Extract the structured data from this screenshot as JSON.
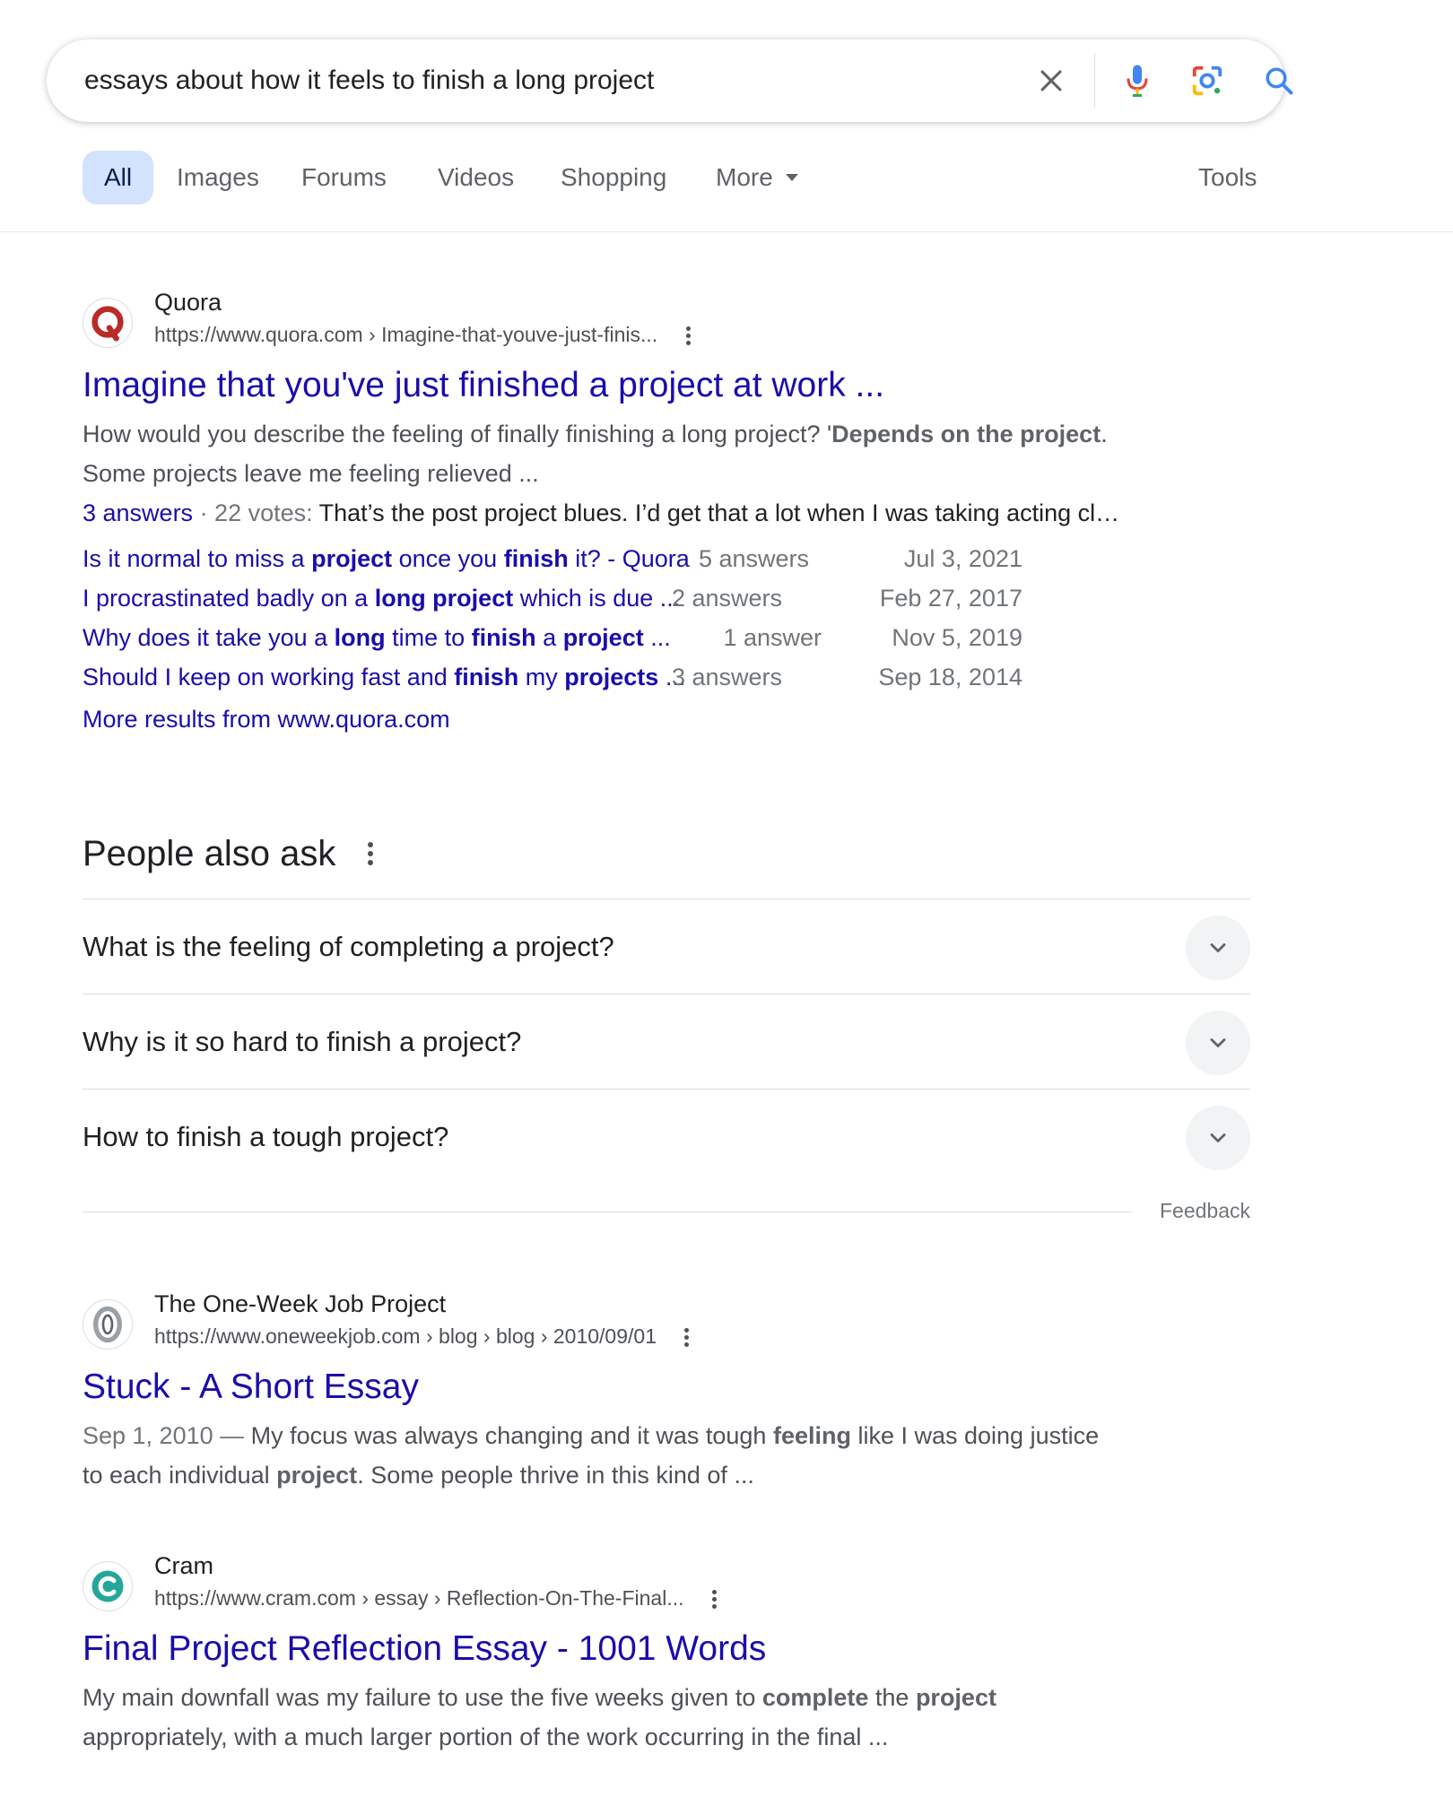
{
  "search": {
    "query": "essays about how it feels to finish a long project",
    "icons": [
      "clear-icon",
      "mic-icon",
      "lens-icon",
      "search-icon"
    ]
  },
  "tabs": [
    {
      "label": "All",
      "active": true
    },
    {
      "label": "Images"
    },
    {
      "label": "Forums"
    },
    {
      "label": "Videos"
    },
    {
      "label": "Shopping"
    },
    {
      "label": "More"
    },
    {
      "label": "Tools"
    }
  ],
  "results": [
    {
      "site": "Quora",
      "url": "https://www.quora.com › Imagine-that-youve-just-finis...",
      "title": "Imagine that you've just finished a project at work ...",
      "snippet_line1_a": "How would you describe the feeling of finally finishing a long project? '",
      "snippet_line1_b": "Depends on the project",
      "snippet_line1_c": ".",
      "snippet_line2": "Some projects leave me feeling relieved ...",
      "answers": "3 answers",
      "votes": " · 22 votes: ",
      "answer_snippet": "That’s the post project blues. I’d get that a lot when I was taking acting cl…",
      "sublinks": [
        {
          "parts": [
            "Is it normal to miss a ",
            "project",
            " once you ",
            "finish",
            " it? - Quora"
          ],
          "answers": "5 answers",
          "date": "Jul 3, 2021"
        },
        {
          "parts": [
            "I procrastinated badly on a ",
            "long project",
            " which is due ..."
          ],
          "answers": "2 answers",
          "date": "Feb 27, 2017"
        },
        {
          "parts": [
            "Why does it take you a ",
            "long",
            " time to ",
            "finish",
            " a ",
            "project",
            " ..."
          ],
          "answers": "1 answer",
          "date": "Nov 5, 2019"
        },
        {
          "parts": [
            "Should I keep on working fast and ",
            "finish",
            " my ",
            "projects",
            " ..."
          ],
          "answers": "3 answers",
          "date": "Sep 18, 2014"
        }
      ],
      "more_results": "More results from www.quora.com"
    },
    {
      "site": "The One-Week Job Project",
      "url": "https://www.oneweekjob.com › blog › blog › 2010/09/01",
      "title": "Stuck - A Short Essay",
      "date": "Sep 1, 2010 —",
      "snippet_a": " My focus was always changing and it was tough ",
      "snippet_b": "feeling",
      "snippet_c": " like I was doing justice",
      "snippet_d": "to each individual ",
      "snippet_e": "project",
      "snippet_f": ". Some people thrive in this kind of ..."
    },
    {
      "site": "Cram",
      "url": "https://www.cram.com › essay › Reflection-On-The-Final...",
      "title": "Final Project Reflection Essay - 1001 Words",
      "snippet_a": "My main downfall was my failure to use the five weeks given to ",
      "snippet_b": "complete",
      "snippet_c": " the ",
      "snippet_d": "project",
      "snippet_e": "appropriately, with a much larger portion of the work occurring in the final ..."
    }
  ],
  "paa": {
    "heading": "People also ask",
    "questions": [
      "What is the feeling of completing a project?",
      "Why is it so hard to finish a project?",
      "How to finish a tough project?"
    ],
    "feedback": "Feedback"
  },
  "colors": {
    "link": "#1a0dab",
    "active_tab_bg": "#d3e3fd",
    "snippet": "#4d5156"
  }
}
